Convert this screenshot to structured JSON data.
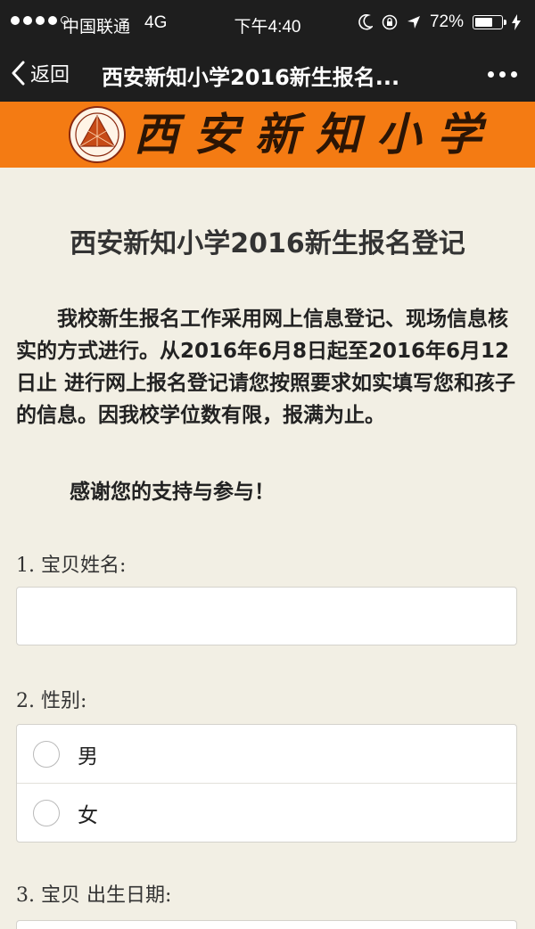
{
  "status_bar": {
    "carrier": "中国联通",
    "network": "4G",
    "time": "下午4:40",
    "battery_percent": "72%",
    "battery_level": 0.72
  },
  "nav": {
    "back_label": "返回",
    "title": "西安新知小学2016新生报名..."
  },
  "banner": {
    "school_name": "西安新知小学"
  },
  "form": {
    "title": "西安新知小学2016新生报名登记",
    "intro": "我校新生报名工作采用网上信息登记、现场信息核实的方式进行。从2016年6月8日起至2016年6月12日止   进行网上报名登记请您按照要求如实填写您和孩子的信息。因我校学位数有限，报满为止。",
    "thanks": "感谢您的支持与参与！",
    "questions": [
      {
        "label": "1. 宝贝姓名:",
        "value": ""
      },
      {
        "label": "2. 性别:",
        "options": [
          "男",
          "女"
        ]
      },
      {
        "label": "3. 宝贝 出生日期:"
      }
    ]
  },
  "colors": {
    "banner_orange": "#f47b13",
    "bar_dark": "#1e1e1e",
    "page_bg": "#f2efe4"
  }
}
